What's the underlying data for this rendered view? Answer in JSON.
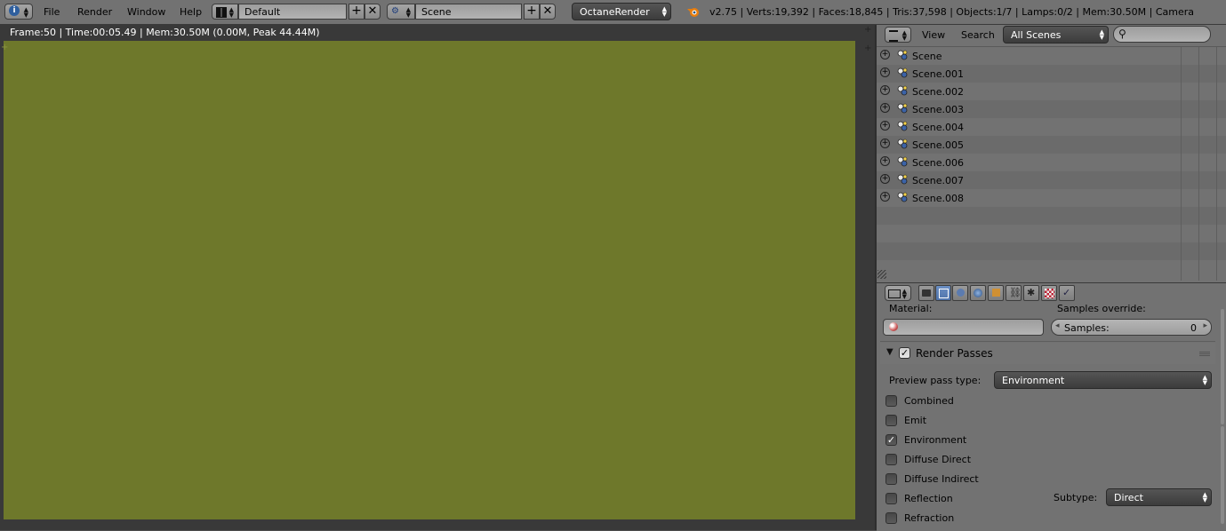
{
  "menu": {
    "file": "File",
    "render": "Render",
    "window": "Window",
    "help": "Help"
  },
  "screen_layout": "Default",
  "scene": "Scene",
  "render_engine": "OctaneRender",
  "stats": "v2.75 | Verts:19,392 | Faces:18,845 | Tris:37,598 | Objects:1/7 | Lamps:0/2 | Mem:30.50M | Camera",
  "viewport": {
    "info": "Frame:50 | Time:00:05.49 | Mem:30.50M (0.00M, Peak 44.44M)",
    "render_color": "#6e782b"
  },
  "outliner": {
    "view_label": "View",
    "search_label": "Search",
    "display_mode": "All Scenes",
    "scenes": [
      "Scene",
      "Scene.001",
      "Scene.002",
      "Scene.003",
      "Scene.004",
      "Scene.005",
      "Scene.006",
      "Scene.007",
      "Scene.008"
    ]
  },
  "properties": {
    "material_label": "Material:",
    "samples_override_label": "Samples override:",
    "samples_label": "Samples:",
    "samples_value": "0",
    "panel_title": "Render Passes",
    "preview_pass_type_label": "Preview pass type:",
    "preview_pass_type_value": "Environment",
    "passes": [
      {
        "label": "Combined",
        "checked": false
      },
      {
        "label": "Emit",
        "checked": false
      },
      {
        "label": "Environment",
        "checked": true
      },
      {
        "label": "Diffuse Direct",
        "checked": false
      },
      {
        "label": "Diffuse Indirect",
        "checked": false
      },
      {
        "label": "Reflection",
        "checked": false
      },
      {
        "label": "Refraction",
        "checked": false
      }
    ],
    "subtype_label": "Subtype:",
    "subtype_value": "Direct"
  },
  "icons": [
    "info-icon",
    "screen-layout-icon",
    "scene-icon",
    "blender-logo-icon",
    "outliner-editor-icon",
    "search-icon",
    "properties-editor-icon",
    "render-tab-icon",
    "render-layers-tab-icon",
    "scene-tab-icon",
    "world-tab-icon",
    "object-tab-icon",
    "constraints-tab-icon",
    "modifiers-tab-icon",
    "texture-tab-icon",
    "particles-tab-icon"
  ]
}
